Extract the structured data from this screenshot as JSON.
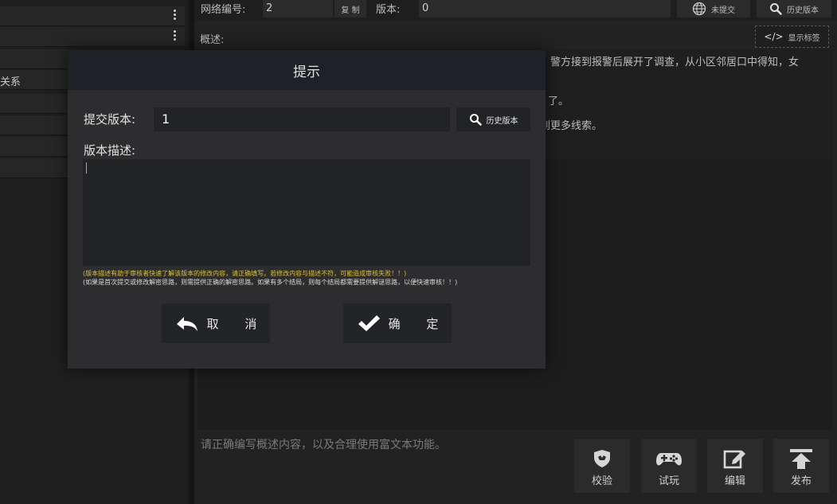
{
  "left_panel": {
    "rows": [
      {
        "label": "",
        "has_menu": true
      },
      {
        "label": "",
        "has_menu": true
      },
      {
        "label": "",
        "has_menu": false
      },
      {
        "label": "关系",
        "has_menu": false
      },
      {
        "label": "",
        "has_menu": false
      },
      {
        "label": "",
        "has_menu": false
      },
      {
        "label": "",
        "has_menu": false
      },
      {
        "label": "",
        "has_menu": false
      }
    ]
  },
  "header": {
    "network_id_label": "网络编号:",
    "network_id_value": "2",
    "copy_label": "复 制",
    "version_label": "版本:",
    "version_value": "0",
    "status_label": "未提交",
    "history_label": "历史版本"
  },
  "summary": {
    "label": "概述:",
    "show_tags_label": "显示标签",
    "lines": [
      "。警方接到报警后展开了调查，从小区邻居口中得知，女",
      "了。",
      "到更多线索。"
    ],
    "hint": "请正确编写概述内容，以及合理使用富文本功能。"
  },
  "actions": [
    {
      "label": "校验",
      "icon": "shield-icon"
    },
    {
      "label": "试玩",
      "icon": "gamepad-icon"
    },
    {
      "label": "编辑",
      "icon": "edit-icon"
    },
    {
      "label": "发布",
      "icon": "publish-icon"
    }
  ],
  "dialog": {
    "title": "提示",
    "submit_version_label": "提交版本:",
    "submit_version_value": "1",
    "history_label": "历史版本",
    "description_label": "版本描述:",
    "description_value": "",
    "warning_yellow": "(版本描述有助于审核者快速了解该版本的修改内容，请正确填写。若修改内容与描述不符，可能造成审核失败！！)",
    "warning_white": "(如果是首次提交或修改解密思路，则需提供正确的解密思路。如果有多个结局，则每个结局都需要提供解谜思路，以便快速审核！！)",
    "cancel_label": "取 消",
    "confirm_label": "确 定"
  },
  "colors": {
    "warning_yellow": "#d8c13a",
    "dialog_bg": "#2d2d2f",
    "dialog_header": "#1e2125"
  }
}
